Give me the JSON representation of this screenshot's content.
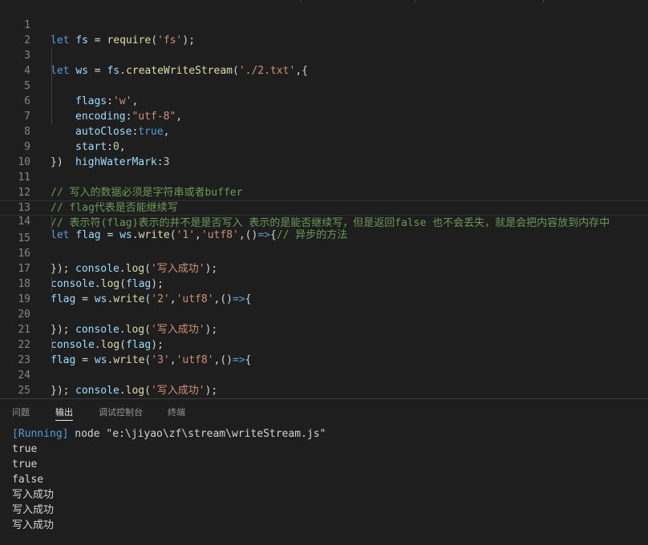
{
  "editor": {
    "line_numbers": [
      "1",
      "2",
      "3",
      "4",
      "5",
      "6",
      "7",
      "8",
      "9",
      "10",
      "11",
      "12",
      "13",
      "14",
      "15",
      "16",
      "17",
      "18",
      "19",
      "20",
      "21",
      "22",
      "23",
      "24",
      "25"
    ],
    "l1": [
      "let",
      " ",
      "fs",
      " = ",
      "require",
      "(",
      "'fs'",
      ");"
    ],
    "l3": [
      "let",
      " ",
      "ws",
      " = ",
      "fs",
      ".",
      "createWriteStream",
      "(",
      "'./2.txt'",
      ",{"
    ],
    "l4": [
      "flags",
      ":",
      "'w'",
      ","
    ],
    "l5": [
      "encoding",
      ":",
      "\"utf-8\"",
      ","
    ],
    "l6": [
      "autoClose",
      ":",
      "true",
      ","
    ],
    "l7": [
      "start",
      ":",
      "0",
      ","
    ],
    "l8": [
      "highWaterMark",
      ":",
      "3"
    ],
    "l9": "})",
    "l11": "// 写入的数据必须是字符串或者buffer",
    "l12": "// flag代表是否能继续写",
    "l13": "// 表示符(flag)表示的并不是是否写入 表示的是能否继续写，但是返回false 也不会丢失，就是会把内容放到内存中",
    "l14": [
      "let",
      " ",
      "flag",
      " = ",
      "ws",
      ".",
      "write",
      "(",
      "'1'",
      ",",
      "'utf8'",
      ",()",
      "=>",
      "{",
      "// 异步的方法"
    ],
    "l15": [
      "console",
      ".",
      "log",
      "(",
      "'写入成功'",
      ");"
    ],
    "l16": "});",
    "l17": [
      "console",
      ".",
      "log",
      "(",
      "flag",
      ");"
    ],
    "l18": [
      "flag",
      " = ",
      "ws",
      ".",
      "write",
      "(",
      "'2'",
      ",",
      "'utf8'",
      ",()",
      "=>",
      "{"
    ],
    "l19": [
      "console",
      ".",
      "log",
      "(",
      "'写入成功'",
      ");"
    ],
    "l20": "});",
    "l21": [
      "console",
      ".",
      "log",
      "(",
      "flag",
      ");"
    ],
    "l22": [
      "flag",
      " = ",
      "ws",
      ".",
      "write",
      "(",
      "'3'",
      ",",
      "'utf8'",
      ",()",
      "=>",
      "{"
    ],
    "l23": [
      "console",
      ".",
      "log",
      "(",
      "'写入成功'",
      ");"
    ],
    "l24": "});",
    "l25": [
      "console",
      ".",
      "log",
      "(",
      "flag",
      ");"
    ]
  },
  "panel": {
    "tabs": [
      "问题",
      "输出",
      "调试控制台",
      "终端"
    ],
    "active_tab": "输出",
    "output": {
      "running_tag": "[Running]",
      "command": " node \"e:\\jiyao\\zf\\stream\\writeStream.js\"",
      "lines": [
        "true",
        "true",
        "false",
        "写入成功",
        "写入成功",
        "写入成功"
      ]
    }
  },
  "colors": {
    "background": "#1e1e1e",
    "keyword": "#569cd6",
    "variable": "#9cdcfe",
    "function": "#dcdcaa",
    "string": "#ce9178",
    "number": "#b5cea8",
    "comment": "#6a9955"
  }
}
